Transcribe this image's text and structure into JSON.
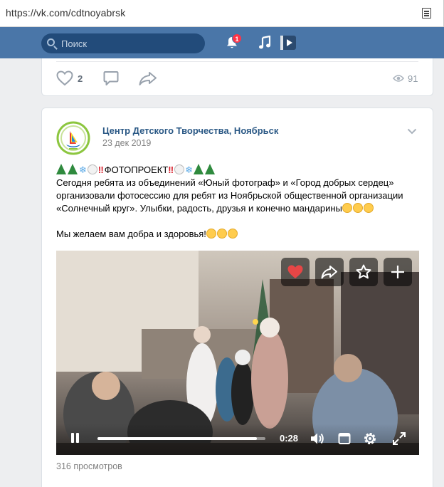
{
  "browser": {
    "url": "https://vk.com/cdtnoyabrsk"
  },
  "header": {
    "search_placeholder": "Поиск",
    "notifications_count": "1",
    "brand_color": "#4a76a8"
  },
  "prev_post": {
    "likes": "2",
    "views": "91"
  },
  "post": {
    "author": "Центр Детского Творчества, Ноябрьск",
    "date": "23 дек 2019",
    "headline": "ФОТОПРОЕКТ",
    "line1": "Сегодня ребята из объединений «Юный фотограф» и «Город добрых сердец»",
    "line2": "организовали фотосессию для ребят из Ноябрьской общественной организации",
    "line3": "«Солнечный круг». Улыбки, радость, друзья и конечно мандарины",
    "line4": "Мы желаем вам добра и здоровья!",
    "video": {
      "time": "0:28",
      "progress": 0.95
    },
    "video_views": "316 просмотров"
  },
  "icons": [
    "search-icon",
    "bell-icon",
    "music-icon",
    "video-icon",
    "like-icon",
    "comment-icon",
    "share-icon",
    "eye-icon",
    "chevron-down-icon",
    "heart-icon",
    "share-arrow-icon",
    "star-icon",
    "plus-icon",
    "pause-icon",
    "volume-icon",
    "miniplayer-icon",
    "gear-icon",
    "fullscreen-icon"
  ]
}
